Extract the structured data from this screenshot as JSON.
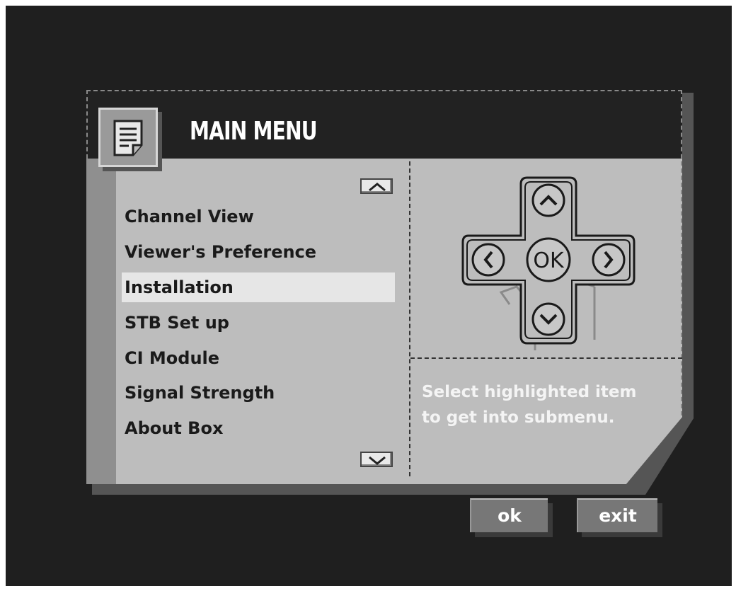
{
  "menu": {
    "title": "MAIN MENU",
    "items": [
      {
        "label": "Channel View"
      },
      {
        "label": "Viewer's Preference"
      },
      {
        "label": "Installation",
        "selected": true
      },
      {
        "label": "STB Set up"
      },
      {
        "label": "CI Module"
      },
      {
        "label": "Signal Strength"
      },
      {
        "label": "About Box"
      }
    ]
  },
  "remote": {
    "ok_label": "OK"
  },
  "help": {
    "text": "Select highlighted item\nto get into submenu."
  },
  "footer": {
    "ok_label": "ok",
    "exit_label": "exit"
  },
  "colors": {
    "background": "#1f1f1f",
    "panel": "#bdbdbd",
    "title_bar": "#222222",
    "highlight": "#e6e6e6"
  }
}
